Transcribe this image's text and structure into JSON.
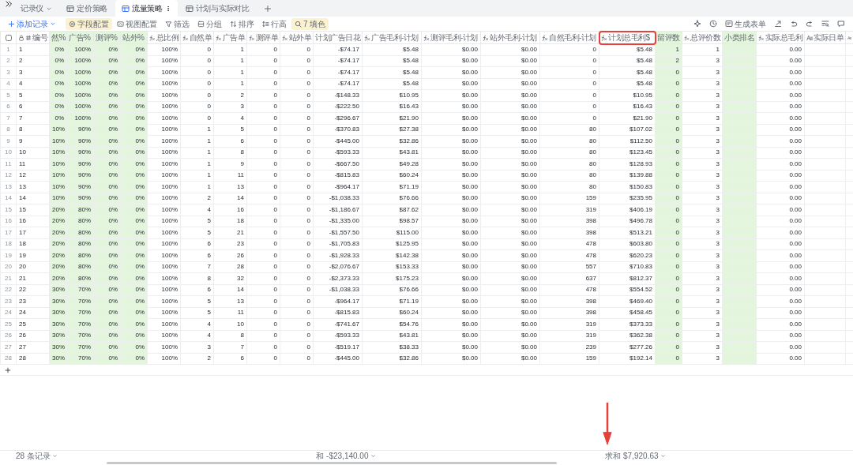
{
  "app": {
    "workspace": "记录仪"
  },
  "tabs": [
    {
      "label": "定价策略",
      "selected": false
    },
    {
      "label": "流量策略",
      "selected": true
    },
    {
      "label": "计划与实际对比",
      "selected": false
    }
  ],
  "toolbar": {
    "add_record": "添加记录",
    "items": [
      {
        "label": "字段配置",
        "highlighted": true
      },
      {
        "label": "视图配置",
        "highlighted": false
      },
      {
        "label": "筛选",
        "highlighted": false
      },
      {
        "label": "分组",
        "highlighted": false
      },
      {
        "label": "排序",
        "highlighted": false
      },
      {
        "label": "行高",
        "highlighted": false
      },
      {
        "label": "7 填色",
        "highlighted": true
      }
    ],
    "form_button": "生成表单"
  },
  "table": {
    "columns": [
      {
        "kind": "index",
        "checked": false
      },
      {
        "kind": "number",
        "label": "编号",
        "locked": true,
        "highlighted": false
      },
      {
        "kind": "plain",
        "label": "然%",
        "highlighted": true
      },
      {
        "kind": "plain",
        "label": "广告%",
        "highlighted": true
      },
      {
        "kind": "plain",
        "label": "测评%",
        "highlighted": true
      },
      {
        "kind": "plain",
        "label": "站外%",
        "highlighted": true
      },
      {
        "kind": "formula",
        "label": "总比例",
        "highlighted": false
      },
      {
        "kind": "formula",
        "label": "自然单",
        "highlighted": false
      },
      {
        "kind": "formula",
        "label": "广告单",
        "highlighted": false
      },
      {
        "kind": "formula",
        "label": "测评单",
        "highlighted": false
      },
      {
        "kind": "formula",
        "label": "站外单",
        "highlighted": false
      },
      {
        "kind": "plain",
        "label": "计划广告日花",
        "highlighted": false,
        "summary": "和 -$23,140.00"
      },
      {
        "kind": "formula",
        "label": "广告毛利-计划",
        "highlighted": false
      },
      {
        "kind": "formula",
        "label": "测评毛利-计划",
        "highlighted": false
      },
      {
        "kind": "formula",
        "label": "站外毛利-计划",
        "highlighted": false
      },
      {
        "kind": "formula",
        "label": "自然毛利-计划",
        "highlighted": false
      },
      {
        "kind": "formula",
        "label": "计划总毛利$",
        "highlighted": false,
        "outlined": true,
        "summary": "求和 $7,920.63"
      },
      {
        "kind": "plain",
        "label": "留评数",
        "highlighted": true
      },
      {
        "kind": "formula",
        "label": "总评价数",
        "highlighted": false
      },
      {
        "kind": "plain",
        "label": "小类排名",
        "highlighted": true
      },
      {
        "kind": "formula",
        "label": "实际总毛利",
        "highlighted": false
      },
      {
        "kind": "text",
        "label": "实际日单",
        "highlighted": false
      },
      {
        "kind": "text",
        "highlighted": false
      }
    ],
    "rows": [
      {
        "cells": [
          "1",
          "1",
          "0%",
          "100%",
          "0%",
          "0%",
          "100%",
          "0",
          "1",
          "0",
          "0",
          "-$74.17",
          "$5.48",
          "$0.00",
          "$0.00",
          "0",
          "$5.48",
          "1",
          "1",
          "",
          "0.00"
        ]
      },
      {
        "cells": [
          "2",
          "2",
          "0%",
          "100%",
          "0%",
          "0%",
          "100%",
          "0",
          "1",
          "0",
          "0",
          "-$74.17",
          "$5.48",
          "$0.00",
          "$0.00",
          "0",
          "$5.48",
          "2",
          "3",
          "",
          "0.00"
        ]
      },
      {
        "cells": [
          "3",
          "3",
          "0%",
          "100%",
          "0%",
          "0%",
          "100%",
          "0",
          "1",
          "0",
          "0",
          "-$74.17",
          "$5.48",
          "$0.00",
          "$0.00",
          "0",
          "$5.48",
          "0",
          "3",
          "",
          "0.00"
        ]
      },
      {
        "cells": [
          "4",
          "4",
          "0%",
          "100%",
          "0%",
          "0%",
          "100%",
          "0",
          "1",
          "0",
          "0",
          "-$74.17",
          "$5.48",
          "$0.00",
          "$0.00",
          "0",
          "$5.48",
          "0",
          "3",
          "",
          "0.00"
        ]
      },
      {
        "cells": [
          "5",
          "5",
          "0%",
          "100%",
          "0%",
          "0%",
          "100%",
          "0",
          "2",
          "0",
          "0",
          "-$148.33",
          "$10.95",
          "$0.00",
          "$0.00",
          "0",
          "$10.95",
          "0",
          "3",
          "",
          "0.00"
        ]
      },
      {
        "cells": [
          "6",
          "6",
          "0%",
          "100%",
          "0%",
          "0%",
          "100%",
          "0",
          "3",
          "0",
          "0",
          "-$222.50",
          "$16.43",
          "$0.00",
          "$0.00",
          "0",
          "$16.43",
          "0",
          "3",
          "",
          "0.00"
        ]
      },
      {
        "cells": [
          "7",
          "7",
          "0%",
          "100%",
          "0%",
          "0%",
          "100%",
          "0",
          "4",
          "0",
          "0",
          "-$296.67",
          "$21.90",
          "$0.00",
          "$0.00",
          "0",
          "$21.90",
          "0",
          "3",
          "",
          "0.00"
        ]
      },
      {
        "cells": [
          "8",
          "8",
          "10%",
          "90%",
          "0%",
          "0%",
          "100%",
          "1",
          "5",
          "0",
          "0",
          "-$370.83",
          "$27.38",
          "$0.00",
          "$0.00",
          "80",
          "$107.02",
          "0",
          "3",
          "",
          "0.00"
        ]
      },
      {
        "cells": [
          "9",
          "9",
          "10%",
          "90%",
          "0%",
          "0%",
          "100%",
          "1",
          "6",
          "0",
          "0",
          "-$445.00",
          "$32.86",
          "$0.00",
          "$0.00",
          "80",
          "$112.50",
          "0",
          "3",
          "",
          "0.00"
        ]
      },
      {
        "cells": [
          "10",
          "10",
          "10%",
          "90%",
          "0%",
          "0%",
          "100%",
          "1",
          "8",
          "0",
          "0",
          "-$593.33",
          "$43.81",
          "$0.00",
          "$0.00",
          "80",
          "$123.45",
          "0",
          "3",
          "",
          "0.00"
        ]
      },
      {
        "cells": [
          "11",
          "11",
          "10%",
          "90%",
          "0%",
          "0%",
          "100%",
          "1",
          "9",
          "0",
          "0",
          "-$667.50",
          "$49.28",
          "$0.00",
          "$0.00",
          "80",
          "$128.93",
          "0",
          "3",
          "",
          "0.00"
        ]
      },
      {
        "cells": [
          "12",
          "12",
          "10%",
          "90%",
          "0%",
          "0%",
          "100%",
          "1",
          "11",
          "0",
          "0",
          "-$815.83",
          "$60.24",
          "$0.00",
          "$0.00",
          "80",
          "$139.88",
          "0",
          "3",
          "",
          "0.00"
        ]
      },
      {
        "cells": [
          "13",
          "13",
          "10%",
          "90%",
          "0%",
          "0%",
          "100%",
          "1",
          "13",
          "0",
          "0",
          "-$964.17",
          "$71.19",
          "$0.00",
          "$0.00",
          "80",
          "$150.83",
          "0",
          "3",
          "",
          "0.00"
        ]
      },
      {
        "cells": [
          "14",
          "14",
          "10%",
          "90%",
          "0%",
          "0%",
          "100%",
          "2",
          "14",
          "0",
          "0",
          "-$1,038.33",
          "$76.66",
          "$0.00",
          "$0.00",
          "159",
          "$235.95",
          "0",
          "3",
          "",
          "0.00"
        ]
      },
      {
        "cells": [
          "15",
          "15",
          "20%",
          "80%",
          "0%",
          "0%",
          "100%",
          "4",
          "16",
          "0",
          "0",
          "-$1,186.67",
          "$87.62",
          "$0.00",
          "$0.00",
          "319",
          "$406.19",
          "0",
          "3",
          "",
          "0.00"
        ]
      },
      {
        "cells": [
          "16",
          "16",
          "20%",
          "80%",
          "0%",
          "0%",
          "100%",
          "5",
          "18",
          "0",
          "0",
          "-$1,335.00",
          "$98.57",
          "$0.00",
          "$0.00",
          "398",
          "$496.78",
          "0",
          "3",
          "",
          "0.00"
        ]
      },
      {
        "cells": [
          "17",
          "17",
          "20%",
          "80%",
          "0%",
          "0%",
          "100%",
          "5",
          "21",
          "0",
          "0",
          "-$1,557.50",
          "$115.00",
          "$0.00",
          "$0.00",
          "398",
          "$513.21",
          "0",
          "3",
          "",
          "0.00"
        ]
      },
      {
        "cells": [
          "18",
          "18",
          "20%",
          "80%",
          "0%",
          "0%",
          "100%",
          "6",
          "23",
          "0",
          "0",
          "-$1,705.83",
          "$125.95",
          "$0.00",
          "$0.00",
          "478",
          "$603.80",
          "0",
          "3",
          "",
          "0.00"
        ]
      },
      {
        "cells": [
          "19",
          "19",
          "20%",
          "80%",
          "0%",
          "0%",
          "100%",
          "6",
          "26",
          "0",
          "0",
          "-$1,928.33",
          "$142.38",
          "$0.00",
          "$0.00",
          "478",
          "$620.23",
          "0",
          "3",
          "",
          "0.00"
        ]
      },
      {
        "cells": [
          "20",
          "20",
          "20%",
          "80%",
          "0%",
          "0%",
          "100%",
          "7",
          "28",
          "0",
          "0",
          "-$2,076.67",
          "$153.33",
          "$0.00",
          "$0.00",
          "557",
          "$710.83",
          "0",
          "3",
          "",
          "0.00"
        ]
      },
      {
        "cells": [
          "21",
          "21",
          "20%",
          "80%",
          "0%",
          "0%",
          "100%",
          "8",
          "32",
          "0",
          "0",
          "-$2,373.33",
          "$175.23",
          "$0.00",
          "$0.00",
          "637",
          "$812.37",
          "0",
          "3",
          "",
          "0.00"
        ]
      },
      {
        "cells": [
          "22",
          "22",
          "30%",
          "70%",
          "0%",
          "0%",
          "100%",
          "6",
          "14",
          "0",
          "0",
          "-$1,038.33",
          "$76.66",
          "$0.00",
          "$0.00",
          "478",
          "$554.52",
          "0",
          "3",
          "",
          "0.00"
        ]
      },
      {
        "cells": [
          "23",
          "23",
          "30%",
          "70%",
          "0%",
          "0%",
          "100%",
          "5",
          "13",
          "0",
          "0",
          "-$964.17",
          "$71.19",
          "$0.00",
          "$0.00",
          "398",
          "$469.40",
          "0",
          "3",
          "",
          "0.00"
        ]
      },
      {
        "cells": [
          "24",
          "24",
          "30%",
          "70%",
          "0%",
          "0%",
          "100%",
          "5",
          "11",
          "0",
          "0",
          "-$815.83",
          "$60.24",
          "$0.00",
          "$0.00",
          "398",
          "$458.45",
          "0",
          "3",
          "",
          "0.00"
        ]
      },
      {
        "cells": [
          "25",
          "25",
          "30%",
          "70%",
          "0%",
          "0%",
          "100%",
          "4",
          "10",
          "0",
          "0",
          "-$741.67",
          "$54.76",
          "$0.00",
          "$0.00",
          "319",
          "$373.33",
          "0",
          "3",
          "",
          "0.00"
        ]
      },
      {
        "cells": [
          "26",
          "26",
          "30%",
          "70%",
          "0%",
          "0%",
          "100%",
          "4",
          "8",
          "0",
          "0",
          "-$593.33",
          "$43.81",
          "$0.00",
          "$0.00",
          "319",
          "$362.38",
          "0",
          "3",
          "",
          "0.00"
        ]
      },
      {
        "cells": [
          "27",
          "27",
          "30%",
          "70%",
          "0%",
          "0%",
          "100%",
          "3",
          "7",
          "0",
          "0",
          "-$519.17",
          "$38.33",
          "$0.00",
          "$0.00",
          "239",
          "$277.26",
          "0",
          "3",
          "",
          "0.00"
        ]
      },
      {
        "cells": [
          "28",
          "28",
          "30%",
          "70%",
          "0%",
          "0%",
          "100%",
          "2",
          "6",
          "0",
          "0",
          "-$445.00",
          "$32.86",
          "$0.00",
          "$0.00",
          "159",
          "$192.14",
          "0",
          "3",
          "",
          "0.00"
        ]
      }
    ],
    "record_count": "28 条记录"
  }
}
